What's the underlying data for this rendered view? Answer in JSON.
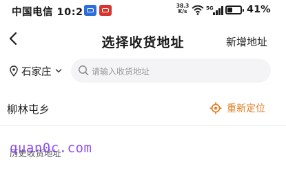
{
  "status_bar": {
    "carrier_time": "中国电信 10:21",
    "net_speed_value": "38.3",
    "net_speed_unit": "K/s",
    "network_type": "5G",
    "battery_percent": "41%",
    "battery_level": 0.41
  },
  "header": {
    "back_icon": "chevron-left-icon",
    "title": "选择收货地址",
    "add_label": "新增地址"
  },
  "search": {
    "city": "石家庄",
    "placeholder": "请输入收货地址"
  },
  "current_location": {
    "name": "柳林屯乡",
    "relocate_label": "重新定位",
    "accent_color": "#e07f26"
  },
  "history": {
    "label": "历史收货地址"
  },
  "watermark": {
    "text": "quan0c.com"
  }
}
